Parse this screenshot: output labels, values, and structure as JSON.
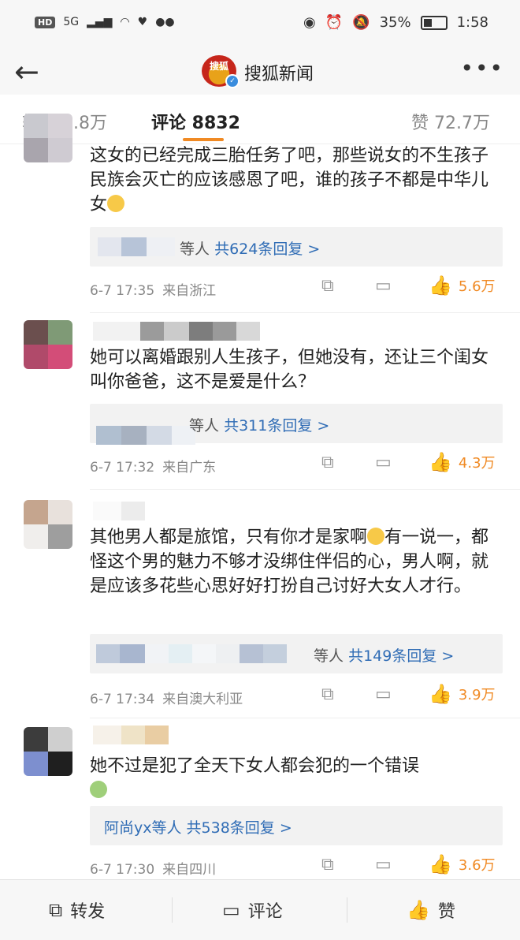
{
  "status": {
    "hd": "HD",
    "net": "5G",
    "battery": "35%",
    "time": "1:58"
  },
  "nav": {
    "logo_text": "搜狐",
    "title": "搜狐新闻"
  },
  "tabs": {
    "repost": "转发 1.8万",
    "comments": "评论 8832",
    "likes": "赞 72.7万"
  },
  "comments": [
    {
      "text": "这女的已经完成三胎任务了吧，那些说女的不生孩子民族会灭亡的应该感恩了吧，谁的孩子不都是中华儿女",
      "reply_who": "等人",
      "reply_count": "共624条回复 >",
      "time": "6-7 17:35",
      "location": "来自浙江",
      "likes": "5.6万"
    },
    {
      "text": "她可以离婚跟别人生孩子，但她没有，还让三个闺女叫你爸爸，这不是爱是什么？",
      "reply_who": "等人",
      "reply_count": "共311条回复 >",
      "time": "6-7 17:32",
      "location": "来自广东",
      "likes": "4.3万"
    },
    {
      "text": "其他男人都是旅馆，只有你才是家啊",
      "text2": "有一说一，都怪这个男的魅力不够才没绑住伴侣的心，男人啊，就是应该多花些心思好好打扮自己讨好大女人才行。",
      "reply_who": "等人",
      "reply_count": "共149条回复 >",
      "time": "6-7 17:34",
      "location": "来自澳大利亚",
      "likes": "3.9万"
    },
    {
      "text": "她不过是犯了全天下女人都会犯的一个错误",
      "reply_who": "阿尚yx等人",
      "reply_count": "共538条回复 >",
      "time": "6-7 17:30",
      "location": "来自四川",
      "likes": "3.6万"
    }
  ],
  "bottom": {
    "repost": "转发",
    "comment": "评论",
    "like": "赞"
  },
  "icons": {
    "back": "back-arrow-icon",
    "more": "more-dots-icon",
    "share": "share-icon",
    "comment": "comment-icon",
    "like": "thumbs-up-icon"
  },
  "colors": {
    "accent": "#f08a24",
    "link": "#2f6cb5"
  }
}
